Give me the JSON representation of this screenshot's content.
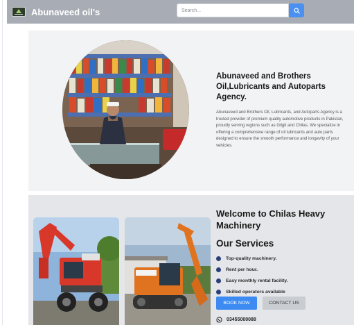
{
  "header": {
    "brand": "Abunaveed oil's",
    "search_placeholder": "Search..."
  },
  "about": {
    "title": "Abunaveed and Brothers Oil,Lubricants and Autoparts Agency.",
    "description": "Abunaveed and Brothers Oil, Lubricants, and Autoparts Agency is a trusted provider of premium quality automotive products in Pakistan, proudly serving regions such as Gilgit and Chilas. We specialize in offering a comprehensive range of oil lubricants and auto parts designed to ensure the smooth performance and longevity of your vehicles."
  },
  "services": {
    "welcome": "Welcome to Chilas Heavy Machinery",
    "title": "Our Services",
    "items": [
      "Top-quality machinery.",
      "Rent per hour.",
      "Easy monthly rental facility.",
      "Skilled operators available"
    ],
    "book_label": "BOOK NOW",
    "contact_label": "CONTACT US",
    "phone": "03455000088"
  },
  "colors": {
    "navbar": "#a8adb5",
    "accent": "#3d8bf2",
    "bullet": "#2a3f7a"
  },
  "icons": {
    "search": "search-icon",
    "phone": "whatsapp-icon",
    "bullet": "bullet-icon"
  }
}
